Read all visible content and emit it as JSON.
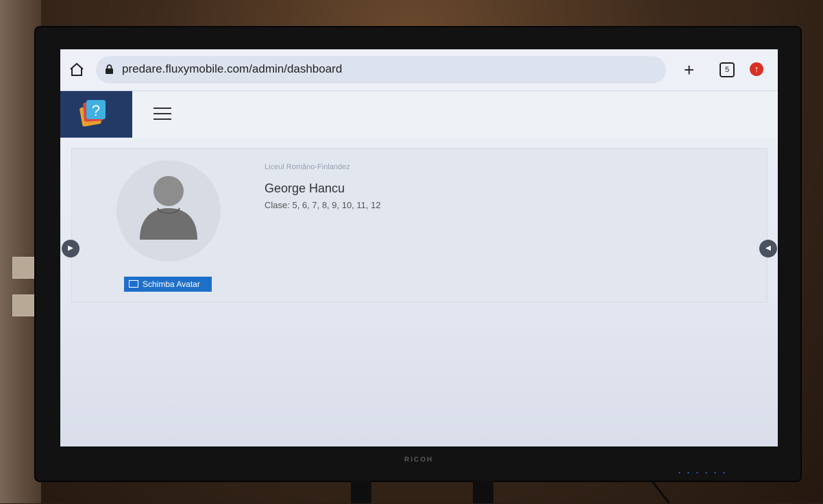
{
  "browser": {
    "url": "predare.fluxymobile.com/admin/dashboard",
    "tab_count": "5",
    "new_tab_symbol": "+",
    "update_symbol": "↑"
  },
  "icons": {
    "home": "home-icon",
    "lock": "lock-icon",
    "menu": "hamburger-menu-icon",
    "logo": "quiz-app-logo-icon",
    "image": "image-icon",
    "arrow_left": "arrow-left-icon",
    "arrow_right": "arrow-right-icon"
  },
  "profile": {
    "school": "Liceul Româno-Finlandez",
    "name": "George Hancu",
    "classes": "Clase: 5, 6, 7, 8, 9, 10, 11, 12",
    "change_avatar_label": "Schimba Avatar"
  },
  "monitor": {
    "brand": "RICOH"
  },
  "colors": {
    "header_logo_bg": "#233a66",
    "primary_button": "#1e6fc9",
    "update_badge": "#d93025"
  }
}
